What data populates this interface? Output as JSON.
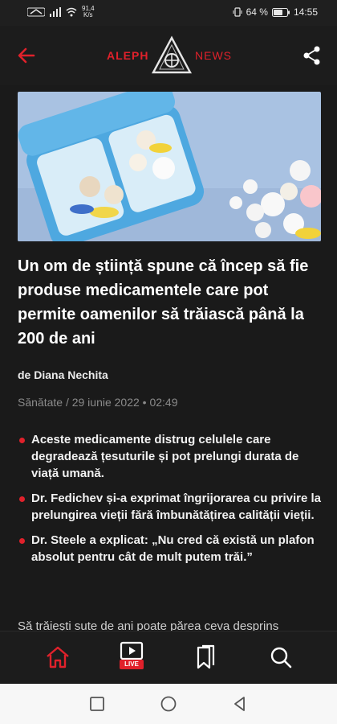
{
  "status_bar": {
    "speed_value": "91,4",
    "speed_unit": "K/s",
    "battery": "64 %",
    "time": "14:55"
  },
  "header": {
    "brand_left": "ALEPH",
    "brand_right": "NEWS"
  },
  "article": {
    "headline": "Un om de știință spune că încep să fie produse medicamentele care pot permite oamenilor să trăiască până la 200 de ani",
    "byline_prefix": "de",
    "author": "Diana Nechita",
    "category_date": "Sănătate / 29 iunie 2022 • 02:49",
    "bullets": [
      "Aceste medicamente distrug celulele care degradează țesuturile și pot prelungi durata de viață umană.",
      "Dr. Fedichev și-a exprimat îngrijorarea cu privire la prelungirea vieții fără îmbunătățirea calității vieții.",
      "Dr. Steele a explicat: „Nu cred că există un plafon absolut pentru cât de mult putem trăi.”"
    ],
    "teaser": "Să trăiești sute de ani poate părea ceva desprins"
  },
  "bottom_nav": {
    "live_badge": "LIVE",
    "active": "home"
  },
  "colors": {
    "accent": "#e0212b",
    "background": "#1a1a1a",
    "text": "#ffffff",
    "meta_text": "#8a8a8a"
  },
  "icons": [
    "wifi-icon",
    "signal-icon",
    "vibrate-icon",
    "battery-icon",
    "back-arrow-icon",
    "share-icon",
    "home-icon",
    "live-tv-icon",
    "bookmarks-icon",
    "search-icon",
    "recents-icon",
    "home-circle-icon",
    "back-triangle-icon"
  ]
}
